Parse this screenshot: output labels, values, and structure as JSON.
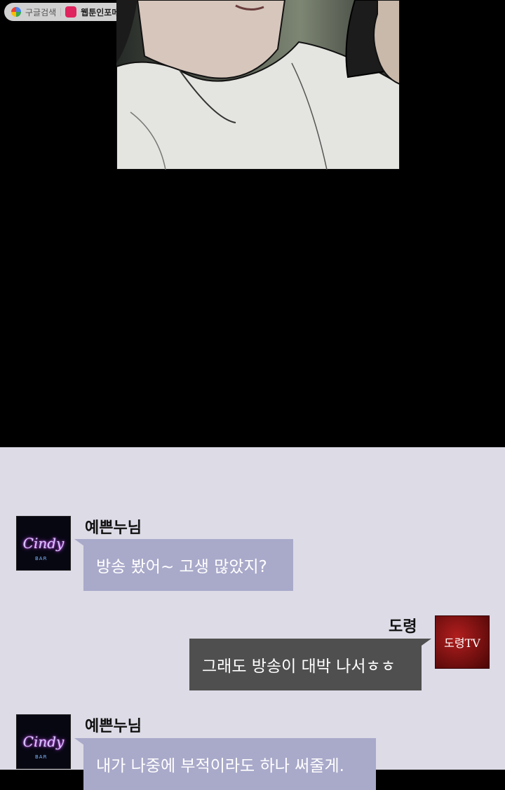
{
  "top_bar": {
    "google_search_label": "구글검색",
    "webtoon_info_label": "웹툰인포메이션"
  },
  "chat": {
    "messages": [
      {
        "sender": "예쁜누님",
        "avatar_text": "Cindy",
        "avatar_sub": "BAR",
        "text": "방송 봤어~ 고생 많았지?"
      },
      {
        "sender": "도령",
        "avatar_text": "도령TV",
        "text": "그래도 방송이 대박 나서ㅎㅎ"
      },
      {
        "sender": "예쁜누님",
        "avatar_text": "Cindy",
        "avatar_sub": "BAR",
        "text": "내가 나중에 부적이라도 하나 써줄게."
      }
    ]
  },
  "colors": {
    "chat_background": "#dcdbe6",
    "bubble_left": "#a9a9ca",
    "bubble_right": "#4f4f4f",
    "page_background": "#000000"
  }
}
